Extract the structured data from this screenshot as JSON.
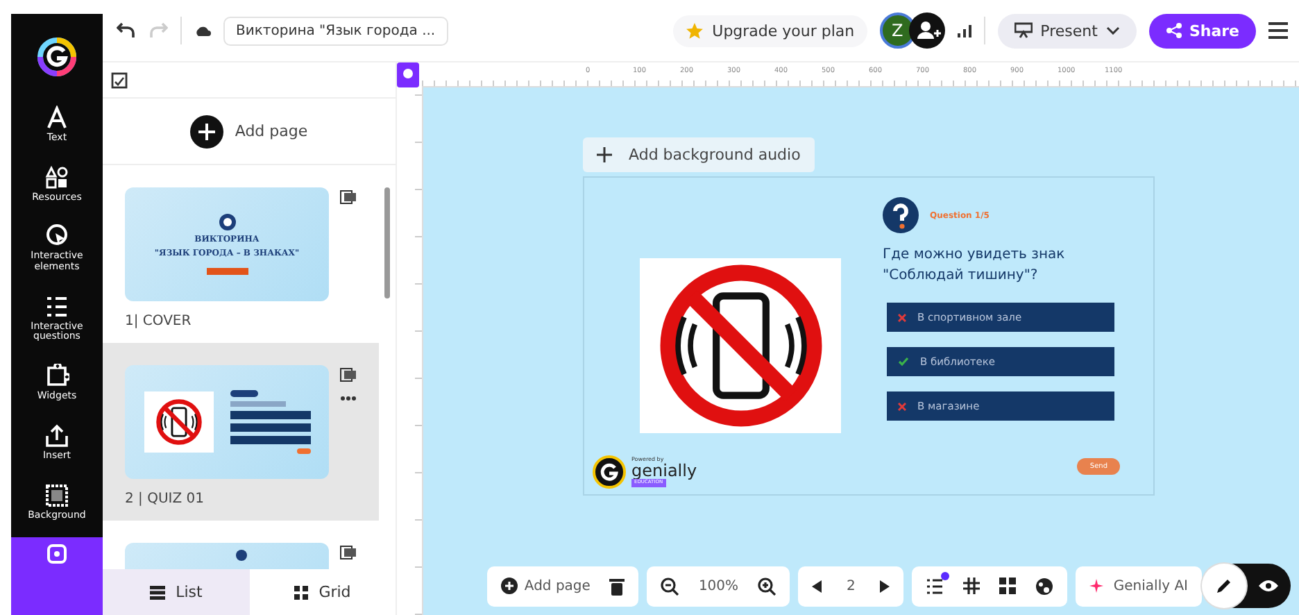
{
  "topbar": {
    "title": "Викторина \"Язык города ...",
    "upgrade": "Upgrade your plan",
    "avatar": "Z",
    "present": "Present",
    "share": "Share"
  },
  "sidebar": {
    "items": [
      {
        "label": "Text",
        "kind": "text",
        "selected": false
      },
      {
        "label": "Resources",
        "kind": "resources",
        "selected": false
      },
      {
        "label": "Interactive elements",
        "kind": "interactive",
        "selected": false
      },
      {
        "label": "Interactive questions",
        "kind": "questions",
        "selected": false
      },
      {
        "label": "Widgets",
        "kind": "widgets",
        "selected": false
      },
      {
        "label": "Insert",
        "kind": "insert",
        "selected": false
      },
      {
        "label": "Background",
        "kind": "background",
        "selected": false
      },
      {
        "kind": "apps",
        "selected": true
      }
    ]
  },
  "pages": {
    "add_page": "Add page",
    "items": [
      {
        "label": "1| COVER",
        "kind": "cover",
        "title": "ВИКТОРИНА",
        "subtitle": "\"ЯЗЫК ГОРОДА – В ЗНАКАХ\"",
        "selected": false
      },
      {
        "label": "2 | QUIZ 01",
        "kind": "quiz",
        "selected": true
      },
      {
        "kind": "partial",
        "selected": false
      }
    ],
    "tabs": [
      {
        "label": "List",
        "selected": true
      },
      {
        "label": "Grid",
        "selected": false
      }
    ]
  },
  "ruler": {
    "labels": [
      "0",
      "100",
      "200",
      "300",
      "400",
      "500",
      "600",
      "700",
      "800",
      "900",
      "1000",
      "1100"
    ]
  },
  "canvas": {
    "add_audio": "Add background audio",
    "slide": {
      "question_number": "Question 1/5",
      "question": "Где можно увидеть знак \"Соблюдай тишину\"?",
      "answers": [
        {
          "text": "В спортивном зале",
          "correct": false
        },
        {
          "text": "В библиотеке",
          "correct": true
        },
        {
          "text": "В магазине",
          "correct": false
        }
      ],
      "powered_by": "Powered by",
      "brand": "genially",
      "brand_badge": "EDUCATION",
      "send": "Send"
    }
  },
  "toolbar": {
    "add_page": "Add page",
    "zoom": "100%",
    "page": "2",
    "genially_ai": "Genially AI",
    "notification": true,
    "modes": [
      {
        "kind": "edit",
        "selected": true
      },
      {
        "kind": "preview",
        "selected": false
      }
    ]
  }
}
